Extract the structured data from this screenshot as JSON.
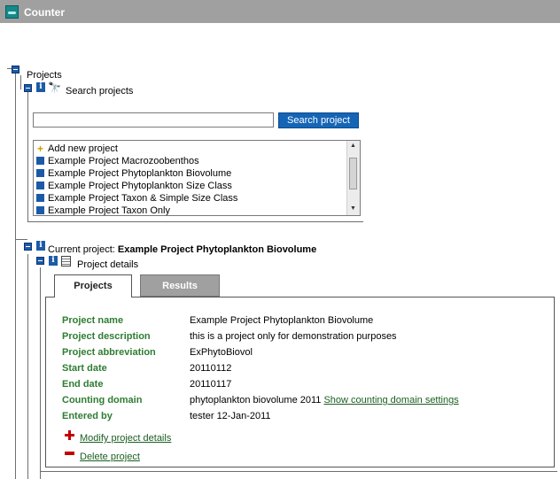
{
  "app": {
    "title": "Counter"
  },
  "tree": {
    "projects_label": "Projects",
    "search_projects_label": "Search projects",
    "current_project_prefix": "Current project:",
    "current_project_name": "Example Project Phytoplankton Biovolume",
    "project_details_label": "Project details"
  },
  "search": {
    "value": "",
    "button_label": "Search project"
  },
  "project_list": {
    "add_new_label": "Add new project",
    "items": [
      "Example Project Macrozoobenthos",
      "Example Project Phytoplankton Biovolume",
      "Example Project Phytoplankton Size Class",
      "Example Project Taxon & Simple Size Class",
      "Example Project Taxon Only"
    ]
  },
  "tabs": [
    {
      "label": "Projects",
      "active": true
    },
    {
      "label": "Results",
      "active": false
    }
  ],
  "details": {
    "fields": [
      {
        "label": "Project name",
        "value": "Example Project Phytoplankton Biovolume"
      },
      {
        "label": "Project description",
        "value": "this is a project only for demonstration purposes"
      },
      {
        "label": "Project abbreviation",
        "value": "ExPhytoBiovol"
      },
      {
        "label": "Start date",
        "value": "20110112"
      },
      {
        "label": "End date",
        "value": "20110117"
      },
      {
        "label": "Counting domain",
        "value": "phytoplankton biovolume 2011",
        "link": "Show counting domain settings"
      },
      {
        "label": "Entered by",
        "value": "tester 12-Jan-2011"
      }
    ],
    "modify_label": "Modify project details",
    "delete_label": "Delete project"
  },
  "colors": {
    "titlebar": "#a0a0a0",
    "accent_blue": "#1c5aa8",
    "label_green": "#2e7d32",
    "delete_red": "#c40000"
  },
  "icons": {
    "app": "counter-icon",
    "toggle": "collapse-icon",
    "info": "info-icon",
    "search": "binoculars-icon",
    "details": "document-icon"
  }
}
